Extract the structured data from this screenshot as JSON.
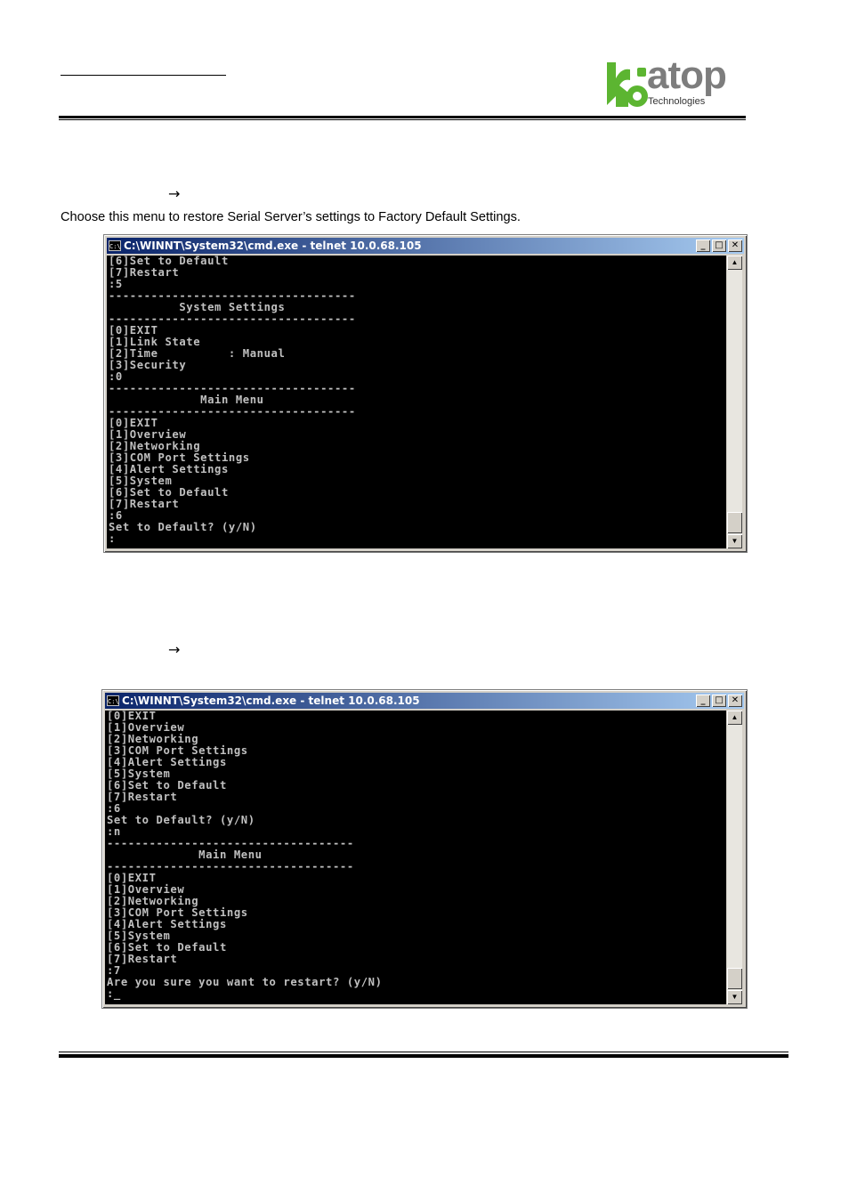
{
  "logo": {
    "brand": "atop",
    "tagline": "Technologies"
  },
  "arrows": [
    "→",
    "→"
  ],
  "description": "Choose this menu to restore Serial Server’s settings to Factory Default Settings.",
  "window1": {
    "title": "C:\\WINNT\\System32\\cmd.exe - telnet 10.0.68.105",
    "icon_text": "C:\\",
    "buttons": {
      "minimize": "_",
      "maximize": "□",
      "close": "✕"
    },
    "console": "[6]Set to Default\n[7]Restart\n:5\n-----------------------------------\n          System Settings\n-----------------------------------\n[0]EXIT\n[1]Link State\n[2]Time          : Manual\n[3]Security\n:0\n-----------------------------------\n             Main Menu\n-----------------------------------\n[0]EXIT\n[1]Overview\n[2]Networking\n[3]COM Port Settings\n[4]Alert Settings\n[5]System\n[6]Set to Default\n[7]Restart\n:6\nSet to Default? (y/N)\n:"
  },
  "window2": {
    "title": "C:\\WINNT\\System32\\cmd.exe - telnet 10.0.68.105",
    "icon_text": "C:\\",
    "buttons": {
      "minimize": "_",
      "maximize": "□",
      "close": "✕"
    },
    "console": "[0]EXIT\n[1]Overview\n[2]Networking\n[3]COM Port Settings\n[4]Alert Settings\n[5]System\n[6]Set to Default\n[7]Restart\n:6\nSet to Default? (y/N)\n:n\n-----------------------------------\n             Main Menu\n-----------------------------------\n[0]EXIT\n[1]Overview\n[2]Networking\n[3]COM Port Settings\n[4]Alert Settings\n[5]System\n[6]Set to Default\n[7]Restart\n:7\nAre you sure you want to restart? (y/N)\n:_"
  },
  "scroll": {
    "up": "▲",
    "down": "▼"
  },
  "colors": {
    "titlebar_start": "#0a246a",
    "titlebar_end": "#a6caf0",
    "logo_green": "#5cb531",
    "logo_gray": "#7d7d7d"
  }
}
